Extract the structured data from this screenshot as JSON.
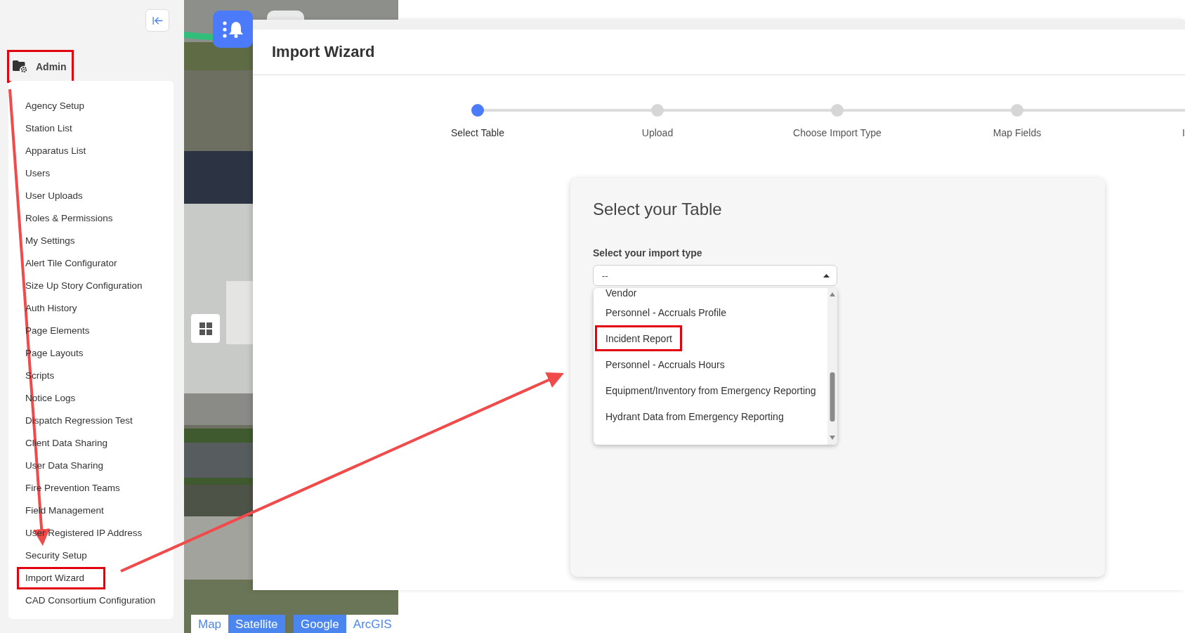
{
  "sidebar": {
    "section": {
      "label": "Admin",
      "highlighted": true
    },
    "items": [
      {
        "label": "Agency Setup",
        "highlighted": false
      },
      {
        "label": "Station List",
        "highlighted": false
      },
      {
        "label": "Apparatus List",
        "highlighted": false
      },
      {
        "label": "Users",
        "highlighted": false
      },
      {
        "label": "User Uploads",
        "highlighted": false
      },
      {
        "label": "Roles & Permissions",
        "highlighted": false
      },
      {
        "label": "My Settings",
        "highlighted": false
      },
      {
        "label": "Alert Tile Configurator",
        "highlighted": false
      },
      {
        "label": "Size Up Story Configuration",
        "highlighted": false
      },
      {
        "label": "Auth History",
        "highlighted": false
      },
      {
        "label": "Page Elements",
        "highlighted": false
      },
      {
        "label": "Page Layouts",
        "highlighted": false
      },
      {
        "label": "Scripts",
        "highlighted": false
      },
      {
        "label": "Notice Logs",
        "highlighted": false
      },
      {
        "label": "Dispatch Regression Test",
        "highlighted": false
      },
      {
        "label": "Client Data Sharing",
        "highlighted": false
      },
      {
        "label": "User Data Sharing",
        "highlighted": false
      },
      {
        "label": "Fire Prevention Teams",
        "highlighted": false
      },
      {
        "label": "Field Management",
        "highlighted": false
      },
      {
        "label": "User Registered IP Address",
        "highlighted": false
      },
      {
        "label": "Security Setup",
        "highlighted": false
      },
      {
        "label": "Import Wizard",
        "highlighted": true
      },
      {
        "label": "CAD Consortium Configuration",
        "highlighted": false
      }
    ]
  },
  "map": {
    "kind": "picture",
    "layer_buttons": [
      {
        "label": "Map",
        "selected": false
      },
      {
        "label": "Satellite",
        "selected": true
      }
    ],
    "provider_buttons": [
      {
        "label": "Google",
        "selected": true
      },
      {
        "label": "ArcGIS",
        "selected": false
      }
    ]
  },
  "wizard": {
    "title": "Import Wizard",
    "steps": [
      {
        "label": "Select Table",
        "selected": true
      },
      {
        "label": "Upload",
        "selected": false
      },
      {
        "label": "Choose Import Type",
        "selected": false
      },
      {
        "label": "Map Fields",
        "selected": false
      },
      {
        "label": "I",
        "selected": false
      }
    ],
    "card": {
      "title": "Select your Table",
      "field_label": "Select your import type",
      "value": "--",
      "options": [
        {
          "label": "Vendor",
          "highlighted": false
        },
        {
          "label": "Personnel - Accruals Profile",
          "highlighted": false
        },
        {
          "label": "Incident Report",
          "highlighted": true
        },
        {
          "label": "Personnel - Accruals Hours",
          "highlighted": false
        },
        {
          "label": "Equipment/Inventory from Emergency Reporting",
          "highlighted": false
        },
        {
          "label": "Hydrant Data from Emergency Reporting",
          "highlighted": false
        }
      ]
    }
  }
}
